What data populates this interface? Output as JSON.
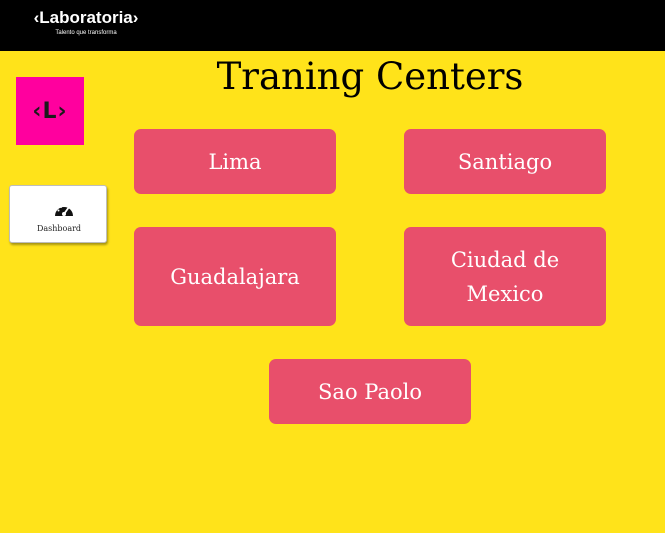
{
  "header": {
    "brand_name": "‹Laboratoria›",
    "brand_tagline": "Talento que transforma"
  },
  "sidebar": {
    "logo_text": "‹L›",
    "dashboard_label": "Dashboard",
    "dashboard_icon": "speedometer-icon"
  },
  "main": {
    "title": "Traning Centers",
    "centers": [
      {
        "label": "Lima"
      },
      {
        "label": "Santiago"
      },
      {
        "label": "Guadalajara"
      },
      {
        "label": "Ciudad de Mexico"
      },
      {
        "label": "Sao Paolo"
      }
    ]
  },
  "colors": {
    "background": "#FFE31A",
    "topbar": "#000000",
    "logo": "#FF009E",
    "button": "#E84F6B"
  }
}
